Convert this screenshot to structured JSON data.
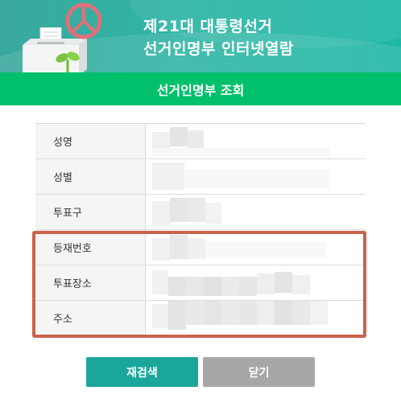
{
  "header": {
    "title_line1": "제21대 대통령선거",
    "title_line2": "선거인명부 인터넷열람"
  },
  "subheader": {
    "title": "선거인명부 조회"
  },
  "rows": [
    {
      "label": "성명"
    },
    {
      "label": "성별"
    },
    {
      "label": "투표구"
    },
    {
      "label": "등재번호"
    },
    {
      "label": "투표장소"
    },
    {
      "label": "주소"
    }
  ],
  "buttons": {
    "research_label": "재검색",
    "close_label": "닫기"
  },
  "colors": {
    "header_teal": "#2fb5a5",
    "subheader_green": "#00c06b",
    "highlight_border": "#c9624a",
    "research_button": "#1aa69a",
    "close_button": "#a7a7a7"
  },
  "icons": [
    "ballot-box-icon",
    "vote-mark-icon",
    "sprout-icon"
  ]
}
